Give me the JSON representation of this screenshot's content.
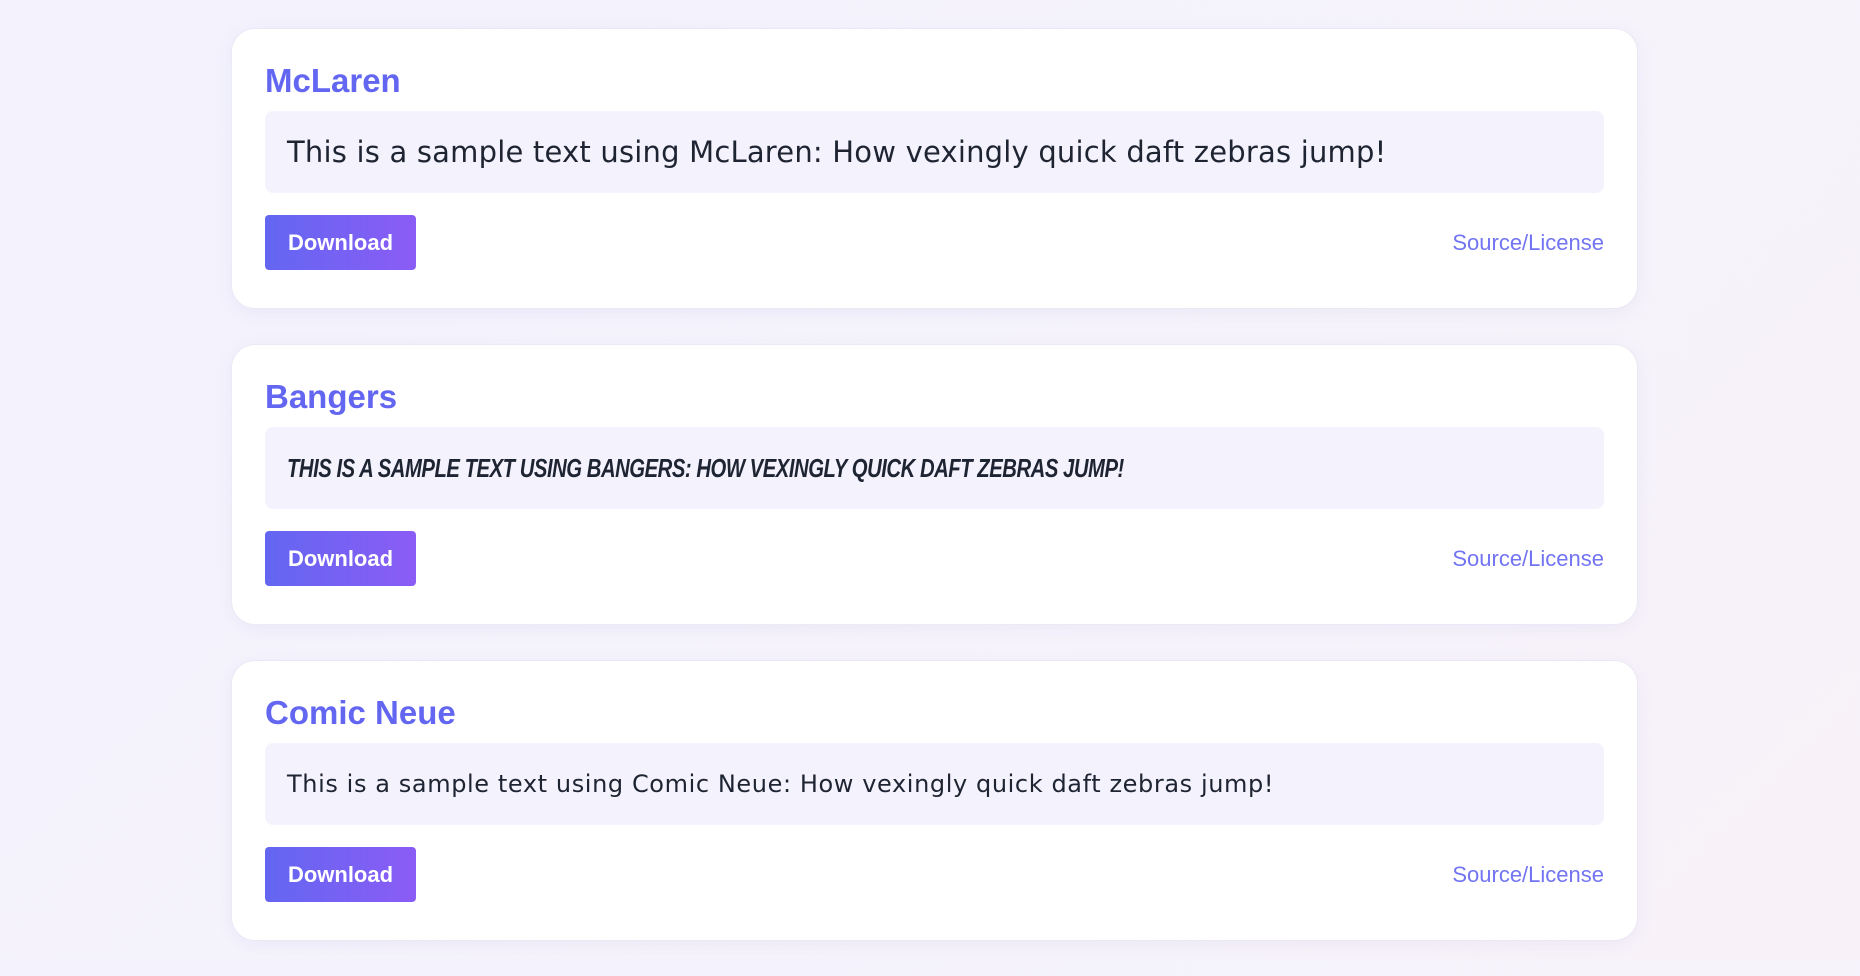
{
  "cards": [
    {
      "name": "McLaren",
      "sample": "This is a sample text using McLaren: How vexingly quick daft zebras jump!",
      "download_label": "Download",
      "link_label": "Source/License"
    },
    {
      "name": "Bangers",
      "sample": "This is a sample text using Bangers: How vexingly quick daft zebras jump!",
      "download_label": "Download",
      "link_label": "Source/License"
    },
    {
      "name": "Comic Neue",
      "sample": "This is a sample text using Comic Neue: How vexingly quick daft zebras jump!",
      "download_label": "Download",
      "link_label": "Source/License"
    }
  ],
  "colors": {
    "accent": "#6366f1",
    "accent_end": "#8b5cf6",
    "sample_bg": "#f3f2fd",
    "text": "#1f2433"
  }
}
